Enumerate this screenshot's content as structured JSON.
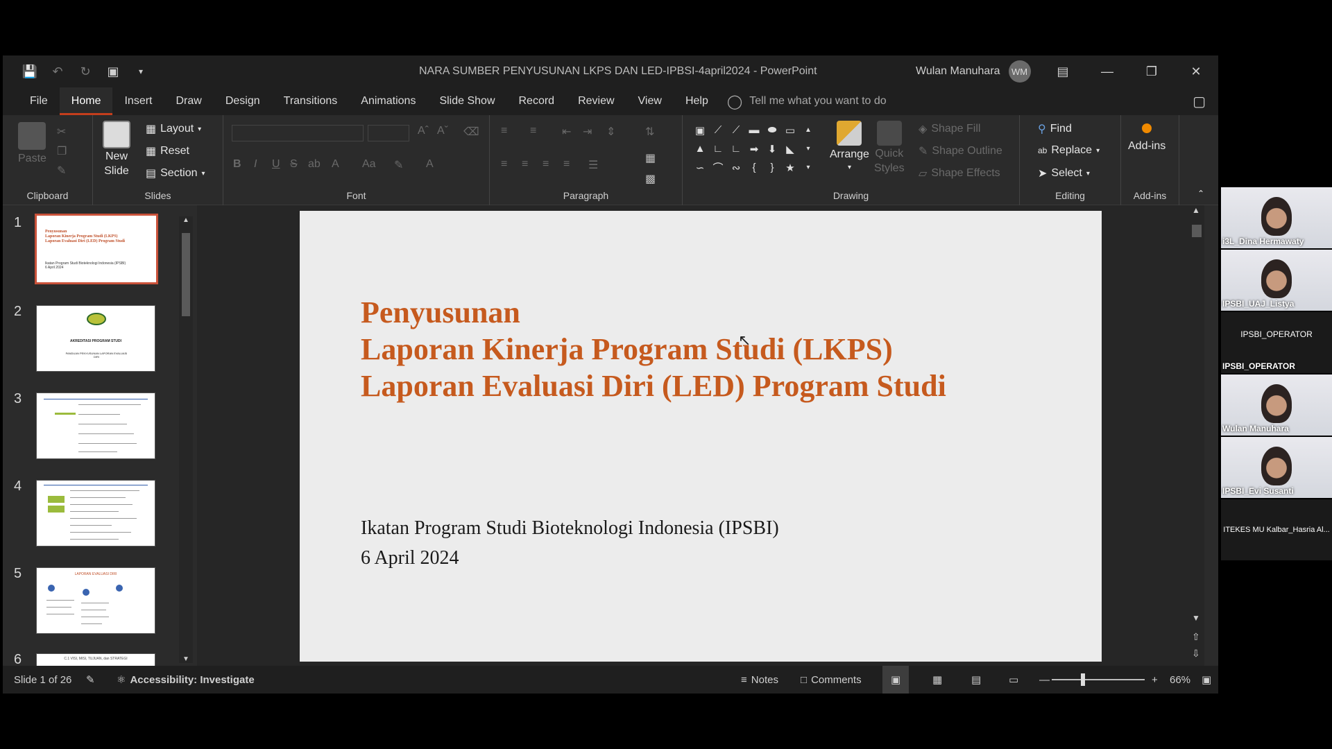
{
  "window": {
    "title": "NARA SUMBER PENYUSUNAN LKPS DAN LED-IPBSI-4april2024  -  PowerPoint",
    "user_name": "Wulan Manuhara",
    "user_initials": "WM"
  },
  "menu": {
    "items": [
      "File",
      "Home",
      "Insert",
      "Draw",
      "Design",
      "Transitions",
      "Animations",
      "Slide Show",
      "Record",
      "Review",
      "View",
      "Help"
    ],
    "active": "Home",
    "tell_me": "Tell me what you want to do"
  },
  "ribbon": {
    "clipboard": {
      "paste": "Paste",
      "label": "Clipboard"
    },
    "slides": {
      "new_slide_1": "New",
      "new_slide_2": "Slide",
      "layout": "Layout",
      "reset": "Reset",
      "section": "Section",
      "label": "Slides"
    },
    "font": {
      "label": "Font",
      "case": "Aa"
    },
    "paragraph": {
      "label": "Paragraph"
    },
    "drawing": {
      "arrange": "Arrange",
      "quick_styles_1": "Quick",
      "quick_styles_2": "Styles",
      "shape_fill": "Shape Fill",
      "shape_outline": "Shape Outline",
      "shape_effects": "Shape Effects",
      "label": "Drawing"
    },
    "editing": {
      "find": "Find",
      "replace": "Replace",
      "select": "Select",
      "label": "Editing"
    },
    "addins": {
      "addins": "Add-ins",
      "label": "Add-ins"
    }
  },
  "thumbnails": [
    {
      "num": "1",
      "line1": "Penyusunan",
      "line2": "Laporan Kinerja Program Studi (LKPS)",
      "line3": "Laporan Evaluasi Diri (LED) Program Studi",
      "sub1": "Ikatan Program Studi Bioteknologi Indonesia (IPSBI)",
      "sub2": "6 April 2024"
    },
    {
      "num": "2",
      "title": "AKREDITASI PROGRAM STUDI",
      "sub": "PANDUAN PENYUSUNAN LAPORAN EVALUASI DIRI"
    },
    {
      "num": "3"
    },
    {
      "num": "4"
    },
    {
      "num": "5",
      "title": "LAPORAN EVALUASI DIRI"
    },
    {
      "num": "6",
      "title": "C.1 VISI, MISI, TUJUAN, dan STRATEGI"
    }
  ],
  "slide": {
    "title_lines": [
      "Penyusunan",
      "Laporan Kinerja Program Studi (LKPS)",
      "Laporan Evaluasi Diri (LED) Program Studi"
    ],
    "subtitle_lines": [
      "Ikatan Program Studi Bioteknologi Indonesia (IPSBI)",
      "6 April 2024"
    ]
  },
  "status": {
    "slide_info": "Slide 1 of 26",
    "accessibility": "Accessibility: Investigate",
    "notes": "Notes",
    "comments": "Comments",
    "zoom": "66%"
  },
  "participants": [
    {
      "name": "i3L_Dina Hermawaty",
      "video": true
    },
    {
      "name": "IPSBI_UAJ_Listya",
      "video": true
    },
    {
      "name": "IPSBI_OPERATOR",
      "video": false,
      "center": "IPSBI_OPERATOR"
    },
    {
      "name": "Wulan Manuhara",
      "video": true
    },
    {
      "name": "IPSBI_Evi Susanti",
      "video": true
    },
    {
      "name": "",
      "video": false,
      "center": "ITEKES MU Kalbar_Hasria Al..."
    }
  ],
  "colors": {
    "accent": "#c43e1c",
    "slide_title": "#c65a1e",
    "window_bg": "#2b2b2b",
    "titlebar_bg": "#1f1f1f"
  }
}
